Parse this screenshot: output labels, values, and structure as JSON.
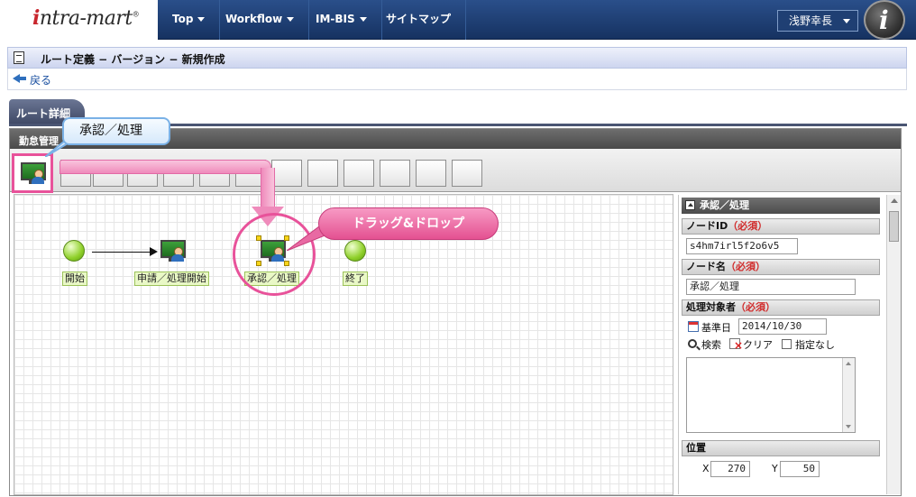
{
  "app": {
    "logo_text_i": "i",
    "logo_text_rest": "ntra-mart",
    "logo_reg": "®"
  },
  "nav": {
    "items": [
      {
        "label": "Top",
        "has_caret": true
      },
      {
        "label": "Workflow",
        "has_caret": true
      },
      {
        "label": "IM-BIS",
        "has_caret": true
      },
      {
        "label": "サイトマップ",
        "has_caret": false
      }
    ],
    "user_name": "浅野幸長",
    "avatar_glyph": "i"
  },
  "page": {
    "title": "ルート定義 − バージョン − 新規作成",
    "back_label": "戻る",
    "tab_label": "ルート詳細",
    "workspace_header": "勤怠管理"
  },
  "canvas": {
    "nodes": [
      {
        "name": "start",
        "label": "開始"
      },
      {
        "name": "apply",
        "label": "申請／処理開始"
      },
      {
        "name": "approve",
        "label": "承認／処理"
      },
      {
        "name": "end",
        "label": "終了"
      }
    ]
  },
  "callouts": {
    "tooltip": "承認／処理",
    "drag_drop": "ドラッグ&ドロップ"
  },
  "panel": {
    "header": "承認／処理",
    "node_id_label": "ノードID",
    "node_id_required": "（必須）",
    "node_id_value": "s4hm7irl5f2o6v5",
    "node_name_label": "ノード名",
    "node_name_required": "（必須）",
    "node_name_value": "承認／処理",
    "target_label": "処理対象者",
    "target_required": "（必須）",
    "base_date_label": "基準日",
    "base_date_value": "2014/10/30",
    "search_label": "検索",
    "clear_label": "クリア",
    "unspecified_label": "指定なし",
    "position_label": "位置",
    "x_label": "X",
    "x_value": "270",
    "y_label": "Y",
    "y_value": "50"
  },
  "colors": {
    "nav_bg": "#163261",
    "highlight_pink": "#e8529a",
    "node_green": "#8fd02a",
    "required_red": "#d12a2a"
  }
}
